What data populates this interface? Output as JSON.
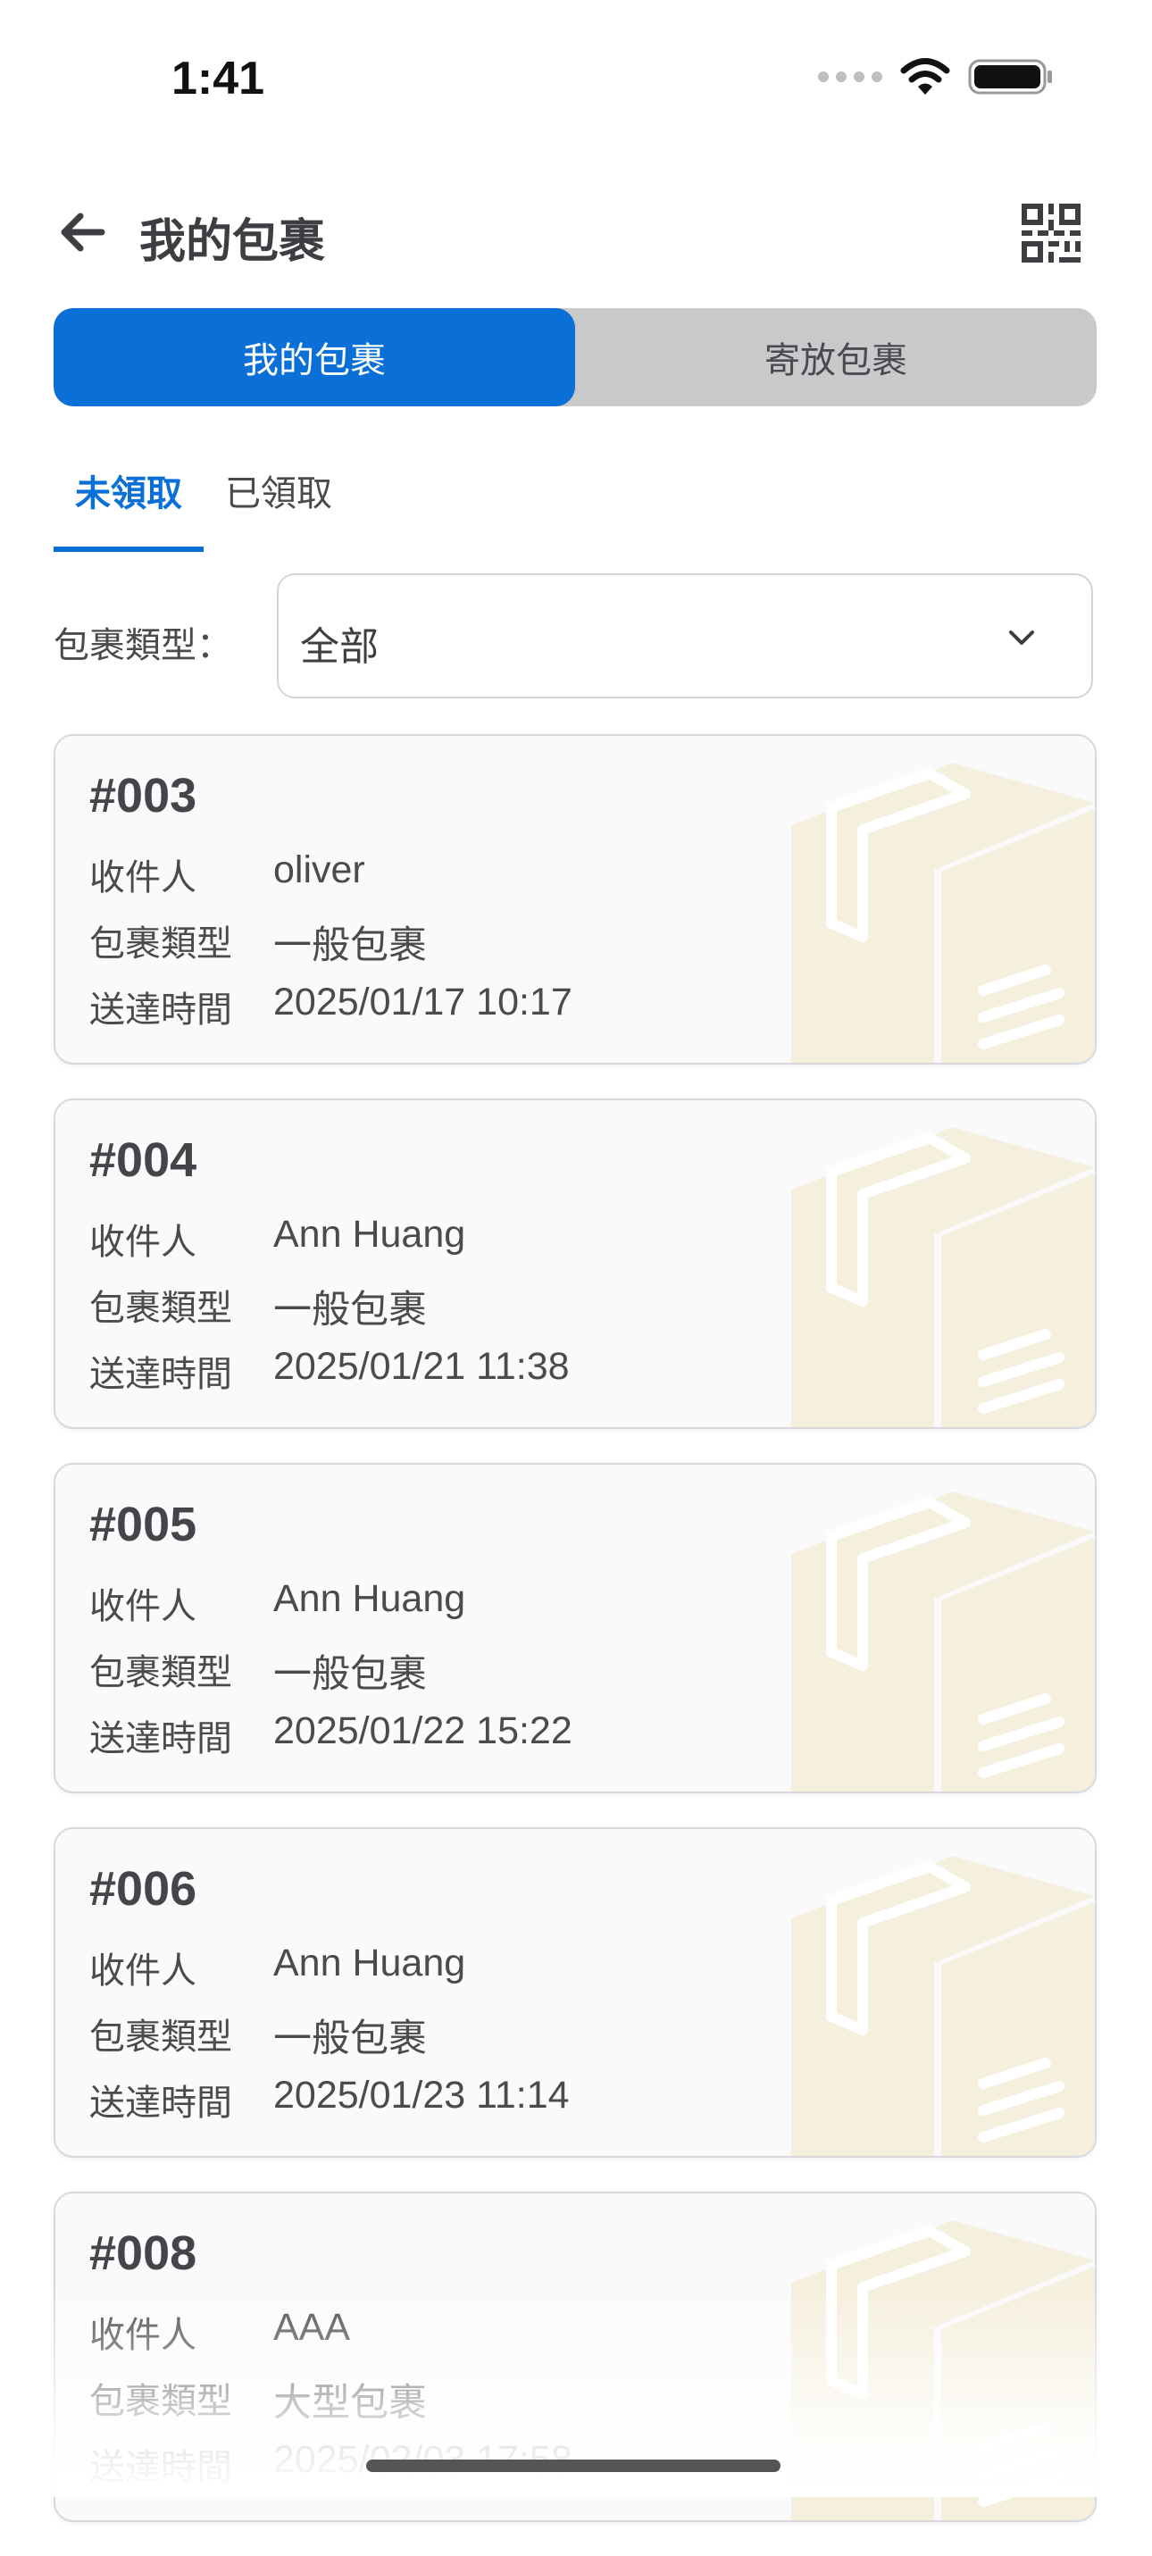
{
  "status_bar": {
    "time": "1:41"
  },
  "header": {
    "title": "我的包裹",
    "back_icon": "arrow-left-icon",
    "qr_icon": "qr-code-icon"
  },
  "segments": [
    {
      "label": "我的包裹",
      "active": true
    },
    {
      "label": "寄放包裹",
      "active": false
    }
  ],
  "tabs": [
    {
      "label": "未領取",
      "active": true
    },
    {
      "label": "已領取",
      "active": false
    }
  ],
  "filter": {
    "label": "包裹類型：",
    "value": "全部"
  },
  "field_labels": {
    "recipient": "收件人",
    "type": "包裹類型",
    "time": "送達時間"
  },
  "packages": [
    {
      "id": "#003",
      "recipient": "oliver",
      "type": "一般包裹",
      "time": "2025/01/17 10:17"
    },
    {
      "id": "#004",
      "recipient": "Ann Huang",
      "type": "一般包裹",
      "time": "2025/01/21 11:38"
    },
    {
      "id": "#005",
      "recipient": "Ann Huang",
      "type": "一般包裹",
      "time": "2025/01/22 15:22"
    },
    {
      "id": "#006",
      "recipient": "Ann Huang",
      "type": "一般包裹",
      "time": "2025/01/23 11:14"
    },
    {
      "id": "#008",
      "recipient": "AAA",
      "type": "大型包裹",
      "time": "2025/02/03 17:58"
    }
  ],
  "colors": {
    "accent": "#0a6fd6",
    "segment_bg": "#c9c9cc",
    "card_bg": "#fafafa",
    "box_illustration": "#f5efdd"
  }
}
